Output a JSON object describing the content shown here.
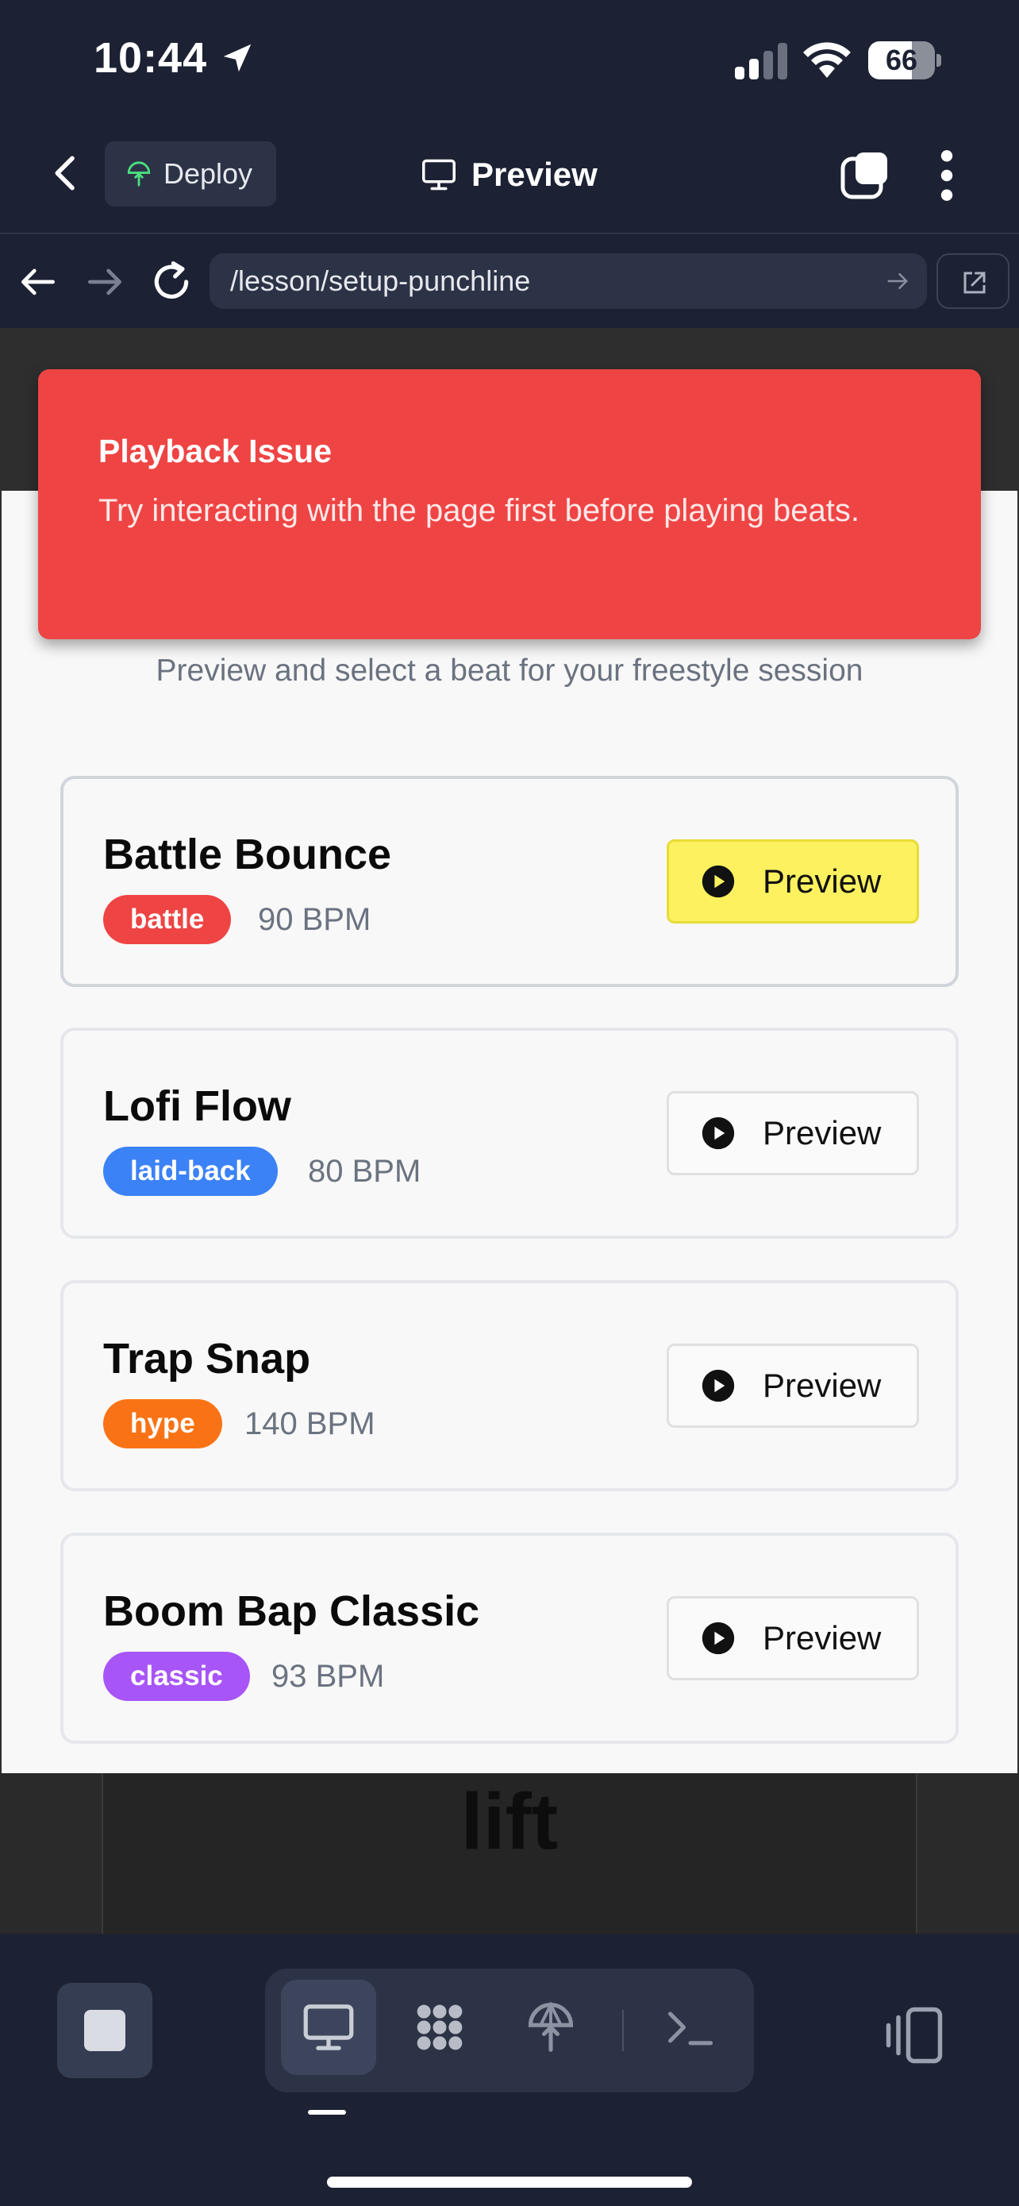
{
  "status_bar": {
    "time": "10:44",
    "battery": "66",
    "battery_level": 0.66
  },
  "header": {
    "deploy_label": "Deploy",
    "title": "Preview"
  },
  "url_bar": {
    "url": "/lesson/setup-punchline"
  },
  "toast": {
    "title": "Playback Issue",
    "message": "Try interacting with the page first before playing beats."
  },
  "page": {
    "subtitle": "Preview and select a beat for your freestyle session",
    "background_word": "lift",
    "beats": [
      {
        "name": "Battle Bounce",
        "tag": "battle",
        "tag_color": "#ef4444",
        "bpm": "90 BPM",
        "button": "Preview",
        "selected": true
      },
      {
        "name": "Lofi Flow",
        "tag": "laid-back",
        "tag_color": "#3b82f6",
        "bpm": "80 BPM",
        "button": "Preview",
        "selected": false
      },
      {
        "name": "Trap Snap",
        "tag": "hype",
        "tag_color": "#f97316",
        "bpm": "140 BPM",
        "button": "Preview",
        "selected": false
      },
      {
        "name": "Boom Bap Classic",
        "tag": "classic",
        "tag_color": "#a855f7",
        "bpm": "93 BPM",
        "button": "Preview",
        "selected": false
      }
    ]
  },
  "colors": {
    "accent_yellow": "#fdf15f",
    "toast_red": "#ef4444",
    "app_bg": "#1c2233"
  },
  "toolbar": {
    "tools": [
      "monitor-icon",
      "apps-icon",
      "deploy-icon",
      "terminal-icon"
    ],
    "active_tool": "monitor-icon"
  }
}
